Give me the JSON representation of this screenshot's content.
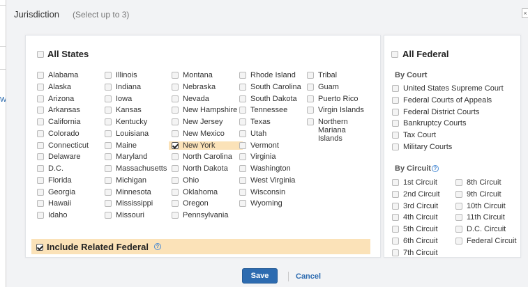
{
  "background": {
    "fragment_text": "We"
  },
  "dialog": {
    "title": "Jurisdiction",
    "subtitle": "(Select up to 3)",
    "close_label": "×"
  },
  "states": {
    "all_label": "All States",
    "columns": [
      [
        {
          "label": "Alabama",
          "checked": false
        },
        {
          "label": "Alaska",
          "checked": false
        },
        {
          "label": "Arizona",
          "checked": false
        },
        {
          "label": "Arkansas",
          "checked": false
        },
        {
          "label": "California",
          "checked": false
        },
        {
          "label": "Colorado",
          "checked": false
        },
        {
          "label": "Connecticut",
          "checked": false
        },
        {
          "label": "Delaware",
          "checked": false
        },
        {
          "label": "D.C.",
          "checked": false
        },
        {
          "label": "Florida",
          "checked": false
        },
        {
          "label": "Georgia",
          "checked": false
        },
        {
          "label": "Hawaii",
          "checked": false
        },
        {
          "label": "Idaho",
          "checked": false
        }
      ],
      [
        {
          "label": "Illinois",
          "checked": false
        },
        {
          "label": "Indiana",
          "checked": false
        },
        {
          "label": "Iowa",
          "checked": false
        },
        {
          "label": "Kansas",
          "checked": false
        },
        {
          "label": "Kentucky",
          "checked": false
        },
        {
          "label": "Louisiana",
          "checked": false
        },
        {
          "label": "Maine",
          "checked": false
        },
        {
          "label": "Maryland",
          "checked": false
        },
        {
          "label": "Massachusetts",
          "checked": false
        },
        {
          "label": "Michigan",
          "checked": false
        },
        {
          "label": "Minnesota",
          "checked": false
        },
        {
          "label": "Mississippi",
          "checked": false
        },
        {
          "label": "Missouri",
          "checked": false
        }
      ],
      [
        {
          "label": "Montana",
          "checked": false
        },
        {
          "label": "Nebraska",
          "checked": false
        },
        {
          "label": "Nevada",
          "checked": false
        },
        {
          "label": "New Hampshire",
          "checked": false
        },
        {
          "label": "New Jersey",
          "checked": false
        },
        {
          "label": "New Mexico",
          "checked": false
        },
        {
          "label": "New York",
          "checked": true
        },
        {
          "label": "North Carolina",
          "checked": false
        },
        {
          "label": "North Dakota",
          "checked": false
        },
        {
          "label": "Ohio",
          "checked": false
        },
        {
          "label": "Oklahoma",
          "checked": false
        },
        {
          "label": "Oregon",
          "checked": false
        },
        {
          "label": "Pennsylvania",
          "checked": false
        }
      ],
      [
        {
          "label": "Rhode Island",
          "checked": false
        },
        {
          "label": "South Carolina",
          "checked": false
        },
        {
          "label": "South Dakota",
          "checked": false
        },
        {
          "label": "Tennessee",
          "checked": false
        },
        {
          "label": "Texas",
          "checked": false
        },
        {
          "label": "Utah",
          "checked": false
        },
        {
          "label": "Vermont",
          "checked": false
        },
        {
          "label": "Virginia",
          "checked": false
        },
        {
          "label": "Washington",
          "checked": false
        },
        {
          "label": "West Virginia",
          "checked": false
        },
        {
          "label": "Wisconsin",
          "checked": false
        },
        {
          "label": "Wyoming",
          "checked": false
        }
      ],
      [
        {
          "label": "Tribal",
          "checked": false
        },
        {
          "label": "Guam",
          "checked": false
        },
        {
          "label": "Puerto Rico",
          "checked": false
        },
        {
          "label": "Virgin Islands",
          "checked": false
        },
        {
          "label": "Northern Mariana Islands",
          "checked": false
        }
      ]
    ],
    "include_related_label": "Include Related Federal",
    "include_related_checked": true
  },
  "federal": {
    "all_label": "All Federal",
    "by_court_heading": "By Court",
    "courts": [
      {
        "label": "United States Supreme Court",
        "checked": false
      },
      {
        "label": "Federal Courts of Appeals",
        "checked": false
      },
      {
        "label": "Federal District Courts",
        "checked": false
      },
      {
        "label": "Bankruptcy Courts",
        "checked": false
      },
      {
        "label": "Tax Court",
        "checked": false
      },
      {
        "label": "Military Courts",
        "checked": false
      }
    ],
    "by_circuit_heading": "By Circuit",
    "circuits_left": [
      {
        "label": "1st Circuit",
        "checked": false
      },
      {
        "label": "2nd Circuit",
        "checked": false
      },
      {
        "label": "3rd Circuit",
        "checked": false
      },
      {
        "label": "4th Circuit",
        "checked": false
      },
      {
        "label": "5th Circuit",
        "checked": false
      },
      {
        "label": "6th Circuit",
        "checked": false
      },
      {
        "label": "7th Circuit",
        "checked": false
      }
    ],
    "circuits_right": [
      {
        "label": "8th Circuit",
        "checked": false
      },
      {
        "label": "9th Circuit",
        "checked": false
      },
      {
        "label": "10th Circuit",
        "checked": false
      },
      {
        "label": "11th Circuit",
        "checked": false
      },
      {
        "label": "D.C. Circuit",
        "checked": false
      },
      {
        "label": "Federal Circuit",
        "checked": false
      }
    ]
  },
  "footer": {
    "save_label": "Save",
    "cancel_label": "Cancel"
  },
  "colors": {
    "accent": "#2d6bb0",
    "highlight": "#fbe2b8",
    "help_icon": "#2d73c4"
  },
  "icons": [
    "help-icon",
    "close-icon",
    "checkbox-icon"
  ]
}
